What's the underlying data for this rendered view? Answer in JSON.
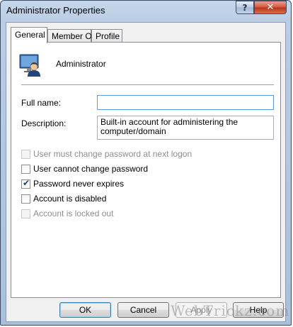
{
  "window": {
    "title": "Administrator Properties"
  },
  "caption_buttons": {
    "help": "?",
    "close": "x"
  },
  "tabs": [
    {
      "label": "General",
      "active": true
    },
    {
      "label": "Member Of",
      "active": false
    },
    {
      "label": "Profile",
      "active": false
    }
  ],
  "general": {
    "account_name": "Administrator",
    "account_icon": "user-account-icon",
    "full_name": {
      "label": "Full name:",
      "value": ""
    },
    "description": {
      "label": "Description:",
      "value": "Built-in account for administering the\ncomputer/domain"
    },
    "options": [
      {
        "label": "User must change password at next logon",
        "checked": false,
        "enabled": false
      },
      {
        "label": "User cannot change password",
        "checked": false,
        "enabled": true
      },
      {
        "label": "Password never expires",
        "checked": true,
        "enabled": true
      },
      {
        "label": "Account is disabled",
        "checked": false,
        "enabled": true
      },
      {
        "label": "Account is locked out",
        "checked": false,
        "enabled": false
      }
    ]
  },
  "buttons": {
    "ok": "OK",
    "cancel": "Cancel",
    "apply": "Apply",
    "help": "Help"
  },
  "watermark": "WebTrickz.com",
  "colors": {
    "default_button_border": "#3c7fb1",
    "close_button": "#c8442a"
  }
}
